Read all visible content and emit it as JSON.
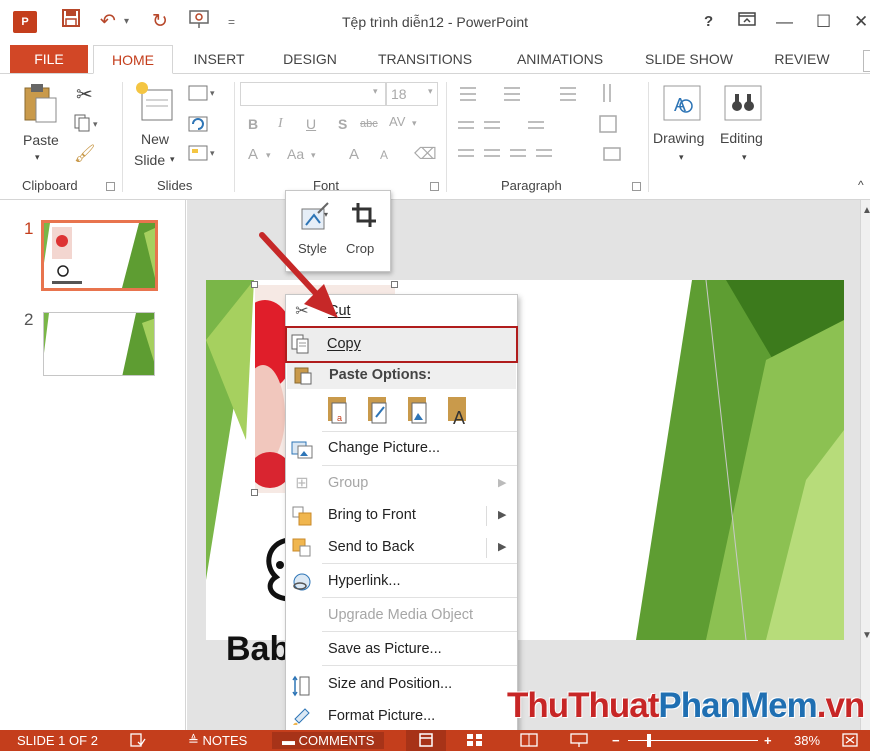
{
  "titlebar": {
    "app_logo": "P",
    "title": "Tệp trình diễn12 - PowerPoint",
    "help": "?",
    "restore_icon": "ribbon-display-icon",
    "minimize": "—",
    "maximize": "☐",
    "close": "✕"
  },
  "tabs": [
    "FILE",
    "HOME",
    "INSERT",
    "DESIGN",
    "TRANSITIONS",
    "ANIMATIONS",
    "SLIDE SHOW",
    "REVIEW"
  ],
  "ribbon": {
    "clipboard": {
      "label": "Clipboard",
      "paste": "Paste"
    },
    "slides": {
      "label": "Slides",
      "new_slide_line1": "New",
      "new_slide_line2": "Slide"
    },
    "font": {
      "label": "Font",
      "size": "18",
      "bold": "B",
      "italic": "I",
      "underline": "U",
      "shadow": "S",
      "strike": "abc",
      "spacing": "AV",
      "font_color": "A",
      "change_case": "Aa",
      "grow": "A",
      "shrink": "A"
    },
    "paragraph": {
      "label": "Paragraph"
    },
    "drawing": {
      "label": "Drawing"
    },
    "editing": {
      "label": "Editing"
    }
  },
  "thumbnails": [
    {
      "number": "1",
      "selected": true
    },
    {
      "number": "2",
      "selected": false
    }
  ],
  "mini_toolbar": {
    "style": "Style",
    "crop": "Crop"
  },
  "slide": {
    "baby_text": "Bab"
  },
  "context_menu": {
    "cut": "Cut",
    "copy": "Copy",
    "paste_options": "Paste Options:",
    "change_picture": "Change Picture...",
    "group": "Group",
    "bring_to_front": "Bring to Front",
    "send_to_back": "Send to Back",
    "hyperlink": "Hyperlink...",
    "upgrade_media": "Upgrade Media Object",
    "save_as_picture": "Save as Picture...",
    "size_and_position": "Size and Position...",
    "format_picture": "Format Picture..."
  },
  "statusbar": {
    "slide_info": "SLIDE 1 OF 2",
    "notes": "NOTES",
    "comments": "COMMENTS",
    "zoom": "38%"
  },
  "watermark": {
    "part1": "ThuThuat",
    "part2": "PhanMem",
    "part3": ".vn"
  },
  "colors": {
    "accent": "#c43e1c",
    "highlight_border": "#b01c1c",
    "green": "#7ab648"
  }
}
